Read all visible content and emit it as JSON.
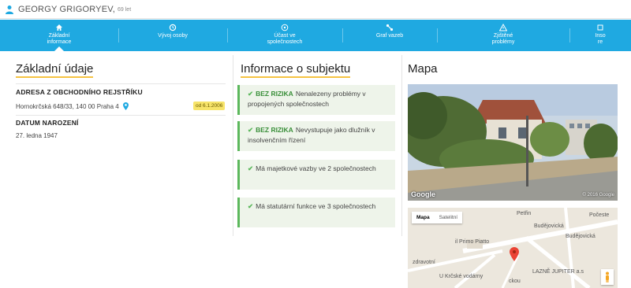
{
  "header": {
    "name": "GEORGY GRIGORYEV,",
    "age": "69 let"
  },
  "nav": {
    "items": [
      {
        "line1": "Základní",
        "line2": "informace",
        "icon": "home-icon",
        "active": true
      },
      {
        "line1": "Vývoj osoby",
        "line2": "",
        "icon": "history-icon"
      },
      {
        "line1": "Účast ve",
        "line2": "společnostech",
        "icon": "network-icon"
      },
      {
        "line1": "Graf vazeb",
        "line2": "",
        "icon": "graph-icon"
      },
      {
        "line1": "Zjištěné",
        "line2": "problémy",
        "icon": "warning-icon"
      },
      {
        "line1": "Inso",
        "line2": "re",
        "icon": "insolvency-icon"
      }
    ]
  },
  "basic": {
    "title": "Základní údaje",
    "registry_heading": "ADRESA Z OBCHODNÍHO REJSTŘÍKU",
    "address": "Hornokrčská 648/33, 140 00 Praha 4",
    "address_since": "od 6.1.2006",
    "birth_heading": "DATUM NAROZENÍ",
    "birth_date": "27. ledna 1947"
  },
  "subject": {
    "title": "Informace o subjektu",
    "cards": [
      {
        "badge": "BEZ RIZIKA",
        "text": "Nenalezeny problémy v propojených společnostech"
      },
      {
        "badge": "BEZ RIZIKA",
        "text": "Nevystupuje jako dlužník v insolvenčním řízení"
      },
      {
        "badge": "",
        "text": "Má majetkové vazby ve 2 společnostech"
      },
      {
        "badge": "",
        "text": "Má statutární funkce ve 3 společnostech"
      }
    ]
  },
  "map": {
    "title": "Mapa",
    "photo_brand": "Google",
    "photo_copyright": "© 2016 Google",
    "toggle": [
      "Mapa",
      "Satelitní"
    ],
    "labels": {
      "street1": "Budějovická",
      "street2": "Budějovická",
      "street3": "Počeste",
      "street4": "Petřin",
      "street5": "U Krčské vodárny",
      "place1": "il Primo Piatto",
      "place2": "zdravotní",
      "place3": "LAZNĚ JUPITER a.s",
      "street6": "ckou"
    }
  },
  "colors": {
    "accent": "#1fa9e1",
    "success": "#5cb85c",
    "highlight": "#f6c342"
  }
}
